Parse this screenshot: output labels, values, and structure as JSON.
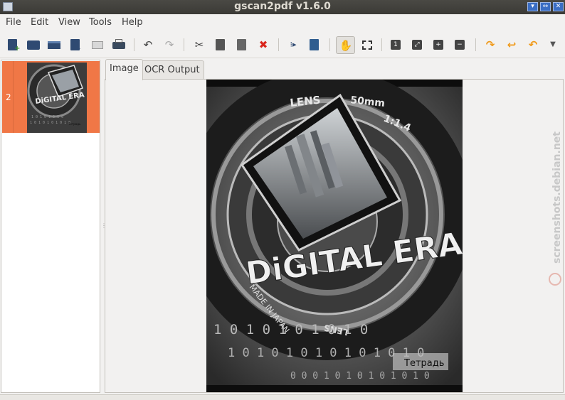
{
  "window": {
    "title": "gscan2pdf v1.6.0",
    "buttons": [
      "minimize",
      "restore",
      "close"
    ]
  },
  "menu": {
    "items": [
      "File",
      "Edit",
      "View",
      "Tools",
      "Help"
    ]
  },
  "toolbar": {
    "icons": [
      "new-document-icon",
      "open-folder-icon",
      "scan-icon",
      "save-icon",
      "email-icon",
      "print-icon",
      "undo-icon",
      "redo-icon",
      "cut-icon",
      "copy-icon",
      "paste-icon",
      "delete-icon",
      "renumber-icon",
      "select-all-icon",
      "hand-tool-icon",
      "selection-tool-icon",
      "zoom-100-icon",
      "zoom-fit-icon",
      "zoom-in-icon",
      "zoom-out-icon",
      "rotate-180-icon",
      "rotate-90-icon",
      "rotate-270-icon",
      "more-icon"
    ]
  },
  "thumbnails": {
    "items": [
      {
        "page_number": "2",
        "selected": true
      }
    ]
  },
  "tabs": {
    "image_label": "Image",
    "ocr_label": "OCR Output",
    "active": "Image"
  },
  "document": {
    "text_lens": "LENS",
    "text_focal": "50mm",
    "text_aperture": "1:1.4",
    "text_title": "DiGITAL ERA",
    "text_made_in": "MADE IN JAPAN",
    "text_lens_bottom": "LENS",
    "text_binary_1": "1 0 1 0 1 0 1 0 1 0",
    "text_binary_2": "1 0 1 0 1 0 1 0 1 0 1 0 1 0",
    "text_binary_3": "0 0 0 1 0 1 0 1 0 1 0 1 0",
    "text_caption": "Тетрадь"
  },
  "watermark": {
    "text": "screenshots.debian.net"
  },
  "colors": {
    "accent_selection": "#f07746",
    "titlebar_bg": "#3b3a36",
    "window_bg": "#f2f1f0",
    "button_blue": "#3b6ec4"
  }
}
